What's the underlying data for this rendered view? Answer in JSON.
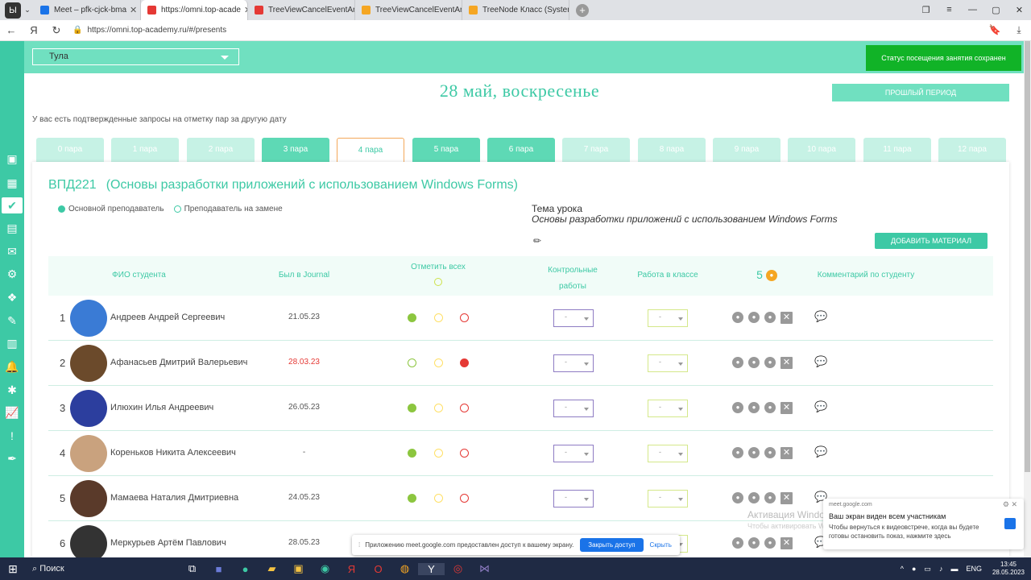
{
  "browser": {
    "tabs": [
      {
        "title": "Meet – pfk-cjck-bma",
        "active": false,
        "color": "#1a73e8"
      },
      {
        "title": "https://omni.top-acade",
        "active": true,
        "color": "#e53935"
      },
      {
        "title": "TreeViewCancelEventArgs",
        "active": false,
        "color": "#e53935"
      },
      {
        "title": "TreeViewCancelEventArgs",
        "active": false,
        "color": "#f5a623"
      },
      {
        "title": "TreeNode Класс (System.W",
        "active": false,
        "color": "#f5a623"
      }
    ],
    "url": "https://omni.top-academy.ru/#/presents"
  },
  "topbar": {
    "city": "Тула",
    "toast": "Статус посещения занятия сохранен"
  },
  "header": {
    "date_title": "28 май, воскресенье",
    "past_button": "ПРОШЛЫЙ ПЕРИОД",
    "notice": "У вас есть подтвержденные запросы на отметку пар за другую дату"
  },
  "pairs": [
    {
      "label": "0 пара",
      "state": "light"
    },
    {
      "label": "1 пара",
      "state": "light"
    },
    {
      "label": "2 пара",
      "state": "light"
    },
    {
      "label": "3 пара",
      "state": "mid"
    },
    {
      "label": "4 пара",
      "state": "active"
    },
    {
      "label": "5 пара",
      "state": "mid"
    },
    {
      "label": "6 пара",
      "state": "mid"
    },
    {
      "label": "7 пара",
      "state": "light"
    },
    {
      "label": "8 пара",
      "state": "light"
    },
    {
      "label": "9 пара",
      "state": "light"
    },
    {
      "label": "10 пара",
      "state": "light"
    },
    {
      "label": "11 пара",
      "state": "light"
    },
    {
      "label": "12 пара",
      "state": "light"
    }
  ],
  "lesson": {
    "group": "ВПД221",
    "subject": "(Основы разработки приложений с использованием Windows Forms)",
    "legend_main": "Основной преподаватель",
    "legend_sub": "Преподаватель на замене",
    "topic_label": "Тема урока",
    "topic": "Основы разработки приложений с использованием Windows Forms",
    "add_material": "ДОБАВИТЬ МАТЕРИАЛ"
  },
  "table": {
    "col_name": "ФИО студента",
    "col_journal": "Был в Journal",
    "col_mark_all": "Отметить всех",
    "col_control": "Контрольные работы",
    "col_classwork": "Работа в классе",
    "col_coins": "5",
    "col_comment": "Комментарий по студенту",
    "select_placeholder": "-",
    "rows": [
      {
        "num": "1",
        "name": "Андреев Андрей Сергеевич",
        "date": "21.05.23",
        "date_red": false,
        "present": true,
        "absent": false
      },
      {
        "num": "2",
        "name": "Афанасьев Дмитрий Валерьевич",
        "date": "28.03.23",
        "date_red": true,
        "present": false,
        "absent": true
      },
      {
        "num": "3",
        "name": "Илюхин Илья Андреевич",
        "date": "26.05.23",
        "date_red": false,
        "present": true,
        "absent": false
      },
      {
        "num": "4",
        "name": "Кореньков Никита Алексеевич",
        "date": "-",
        "date_red": false,
        "present": true,
        "absent": false
      },
      {
        "num": "5",
        "name": "Мамаева Наталия Дмитриевна",
        "date": "24.05.23",
        "date_red": false,
        "present": true,
        "absent": false
      },
      {
        "num": "6",
        "name": "Меркурьев Артём Павлович",
        "date": "28.05.23",
        "date_red": false,
        "present": true,
        "absent": false
      }
    ]
  },
  "meet_bar": {
    "text": "Приложению meet.google.com предоставлен доступ к вашему экрану.",
    "stop": "Закрыть доступ",
    "hide": "Скрыть"
  },
  "activation": {
    "title": "Активация Windows",
    "subtitle": "Чтобы активировать Windows, перейдите в раздел \"Параметры\"."
  },
  "notification": {
    "source": "meet.google.com",
    "title": "Ваш экран виден всем участникам",
    "body": "Чтобы вернуться к видеовстрече, когда вы будете готовы остановить показ, нажмите здесь"
  },
  "taskbar": {
    "search": "Поиск",
    "lang": "ENG",
    "time": "13:45",
    "date": "28.05.2023"
  }
}
